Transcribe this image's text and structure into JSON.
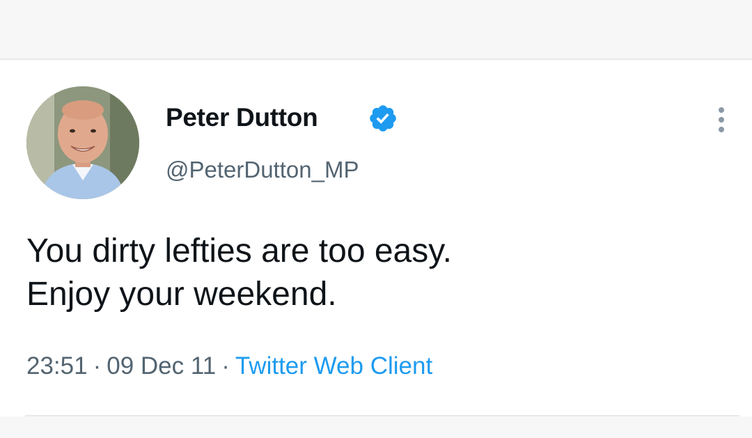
{
  "tweet": {
    "author": {
      "display_name": "Peter Dutton",
      "handle": "@PeterDutton_MP",
      "verified": true,
      "avatar_icon": "profile-photo"
    },
    "text_lines": [
      "You dirty lefties are too easy.",
      "Enjoy your weekend."
    ],
    "time": "23:51",
    "date": "09 Dec 11",
    "separator": "·",
    "source": "Twitter Web Client",
    "more_icon": "more-options-icon"
  },
  "colors": {
    "text_primary": "#0f1419",
    "text_secondary": "#536471",
    "accent": "#1d9bf0",
    "verified_badge": "#1d9bf0"
  }
}
